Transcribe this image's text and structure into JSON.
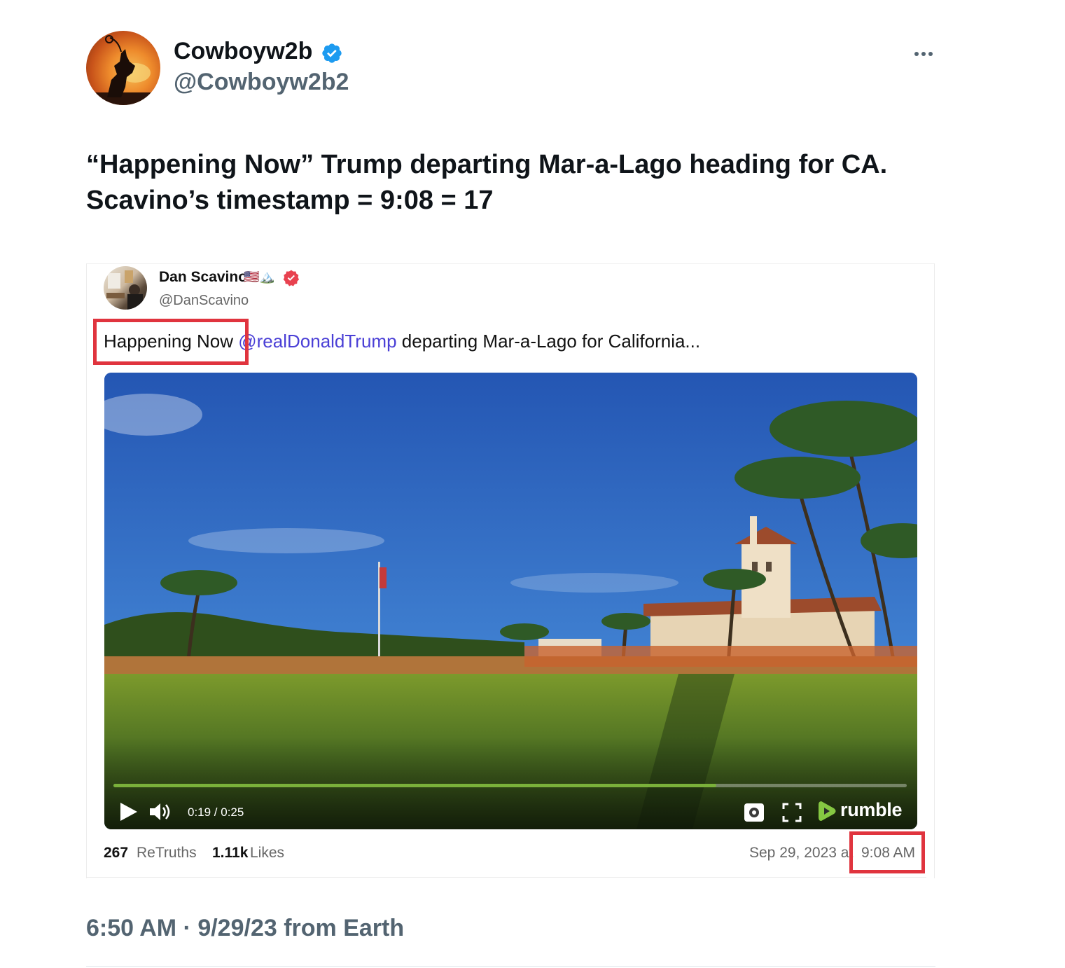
{
  "author": {
    "display_name": "Cowboyw2b",
    "handle": "@Cowboyw2b2"
  },
  "tweet": {
    "text_line1": "“Happening Now” Trump departing Mar-a-Lago heading for CA.",
    "text_line2": "Scavino’s timestamp = 9:08 = 17",
    "meta": "6:50 AM · 9/29/23 from Earth"
  },
  "embed": {
    "author_name": "Dan Scavino",
    "author_emoji": "🇺🇸🏔️",
    "author_handle": "@DanScavino",
    "text_highlight": "Happening Now",
    "mention": "@realDonaldTrump",
    "text_rest": "departing Mar-a-Lago for California...",
    "video": {
      "time": "0:19 / 0:25",
      "progress": 0.76,
      "provider": "rumble"
    },
    "stats": {
      "retruths_count": "267",
      "retruths_label": "ReTruths",
      "likes_count": "1.11k",
      "likes_label": "Likes"
    },
    "date": "Sep 29, 2023 at",
    "time": "9:08 AM"
  },
  "colors": {
    "verified_blue": "#1d9bf0",
    "truth_badge": "#e8414f",
    "highlight_red": "#e0343e",
    "mention": "#4a3fd6",
    "rumble_green": "#85c742"
  },
  "icons": [
    "verified-badge-icon",
    "more-icon",
    "truth-verified-icon",
    "play-icon",
    "volume-icon",
    "settings-icon",
    "fullscreen-icon",
    "rumble-logo-icon"
  ]
}
